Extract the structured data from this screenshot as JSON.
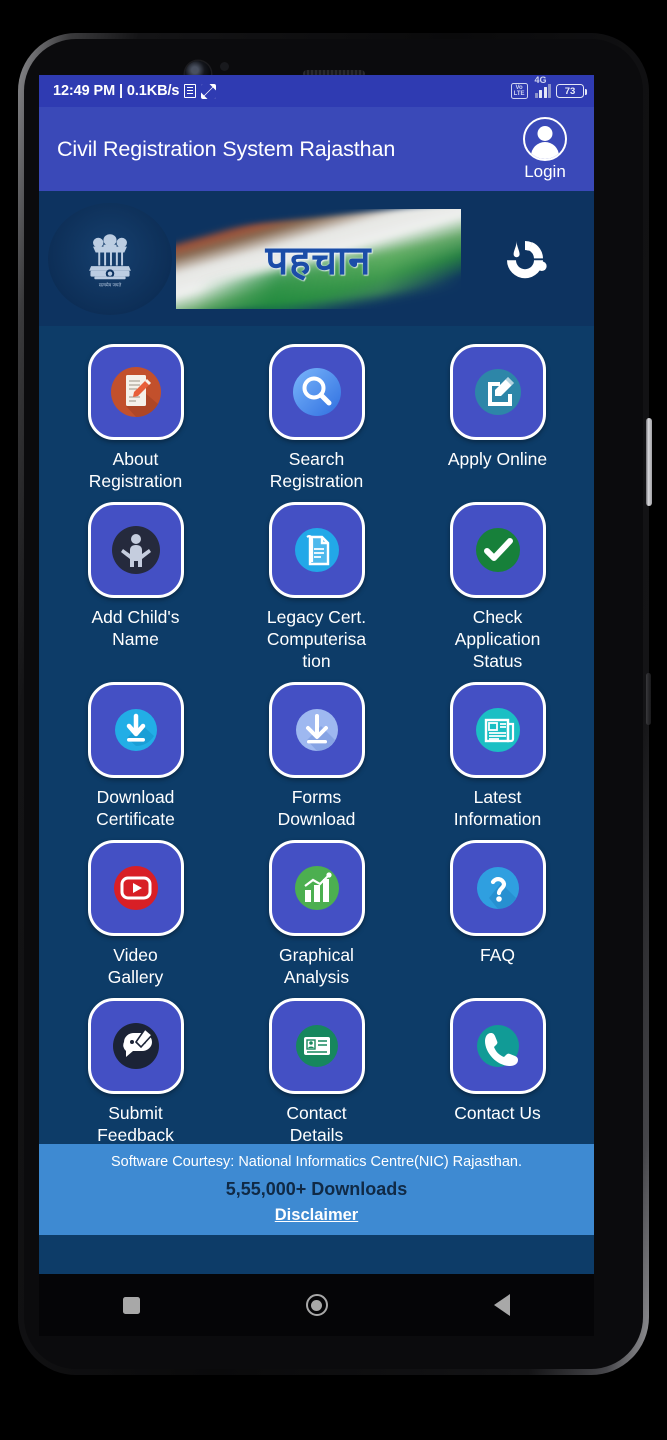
{
  "status_bar": {
    "time_and_speed": "12:49 PM | 0.1KB/s",
    "doc_icon": "document-icon",
    "sync_icon": "sync-icon",
    "volte_line1": "Vo",
    "volte_line2": "LTE",
    "network_type": "4G",
    "battery_percent": "73"
  },
  "app_bar": {
    "title": "Civil Registration System Rajasthan",
    "login_label": "Login",
    "avatar_icon": "user-avatar-icon",
    "background_color": "#3a49b8"
  },
  "banner": {
    "left_emblem": "ashoka-emblem-icon",
    "emblem_motto": "सत्यमेव जयते",
    "center_text": "पहचान",
    "right_logo": "crs-swirl-logo-icon",
    "background_color": "#0d3360"
  },
  "grid": {
    "items": [
      {
        "label": "About\nRegistration",
        "icon": "document-pencil-icon",
        "icon_color": "#c2502c"
      },
      {
        "label": "Search\nRegistration",
        "icon": "magnifier-icon",
        "icon_color": "#3e86f0"
      },
      {
        "label": "Apply Online",
        "icon": "edit-square-icon",
        "icon_color": "#2d86a8"
      },
      {
        "label": "Add Child's\nName",
        "icon": "child-icon",
        "icon_color": "#252a3d"
      },
      {
        "label": "Legacy Cert.\nComputerisa\ntion",
        "icon": "scroll-document-icon",
        "icon_color": "#22a8e8"
      },
      {
        "label": "Check\nApplication\nStatus",
        "icon": "check-circle-icon",
        "icon_color": "#17803a"
      },
      {
        "label": "Download\nCertificate",
        "icon": "download-icon",
        "icon_color": "#22aee6"
      },
      {
        "label": "Forms\nDownload",
        "icon": "download-arrow-icon",
        "icon_color": "#9eb8f0"
      },
      {
        "label": "Latest\nInformation",
        "icon": "newspaper-icon",
        "icon_color": "#1bbfc4"
      },
      {
        "label": "Video\nGallery",
        "icon": "youtube-play-icon",
        "icon_color": "#d81f26"
      },
      {
        "label": "Graphical\nAnalysis",
        "icon": "bar-chart-icon",
        "icon_color": "#4caf50"
      },
      {
        "label": "FAQ",
        "icon": "question-mark-icon",
        "icon_color": "#2f9fe0"
      },
      {
        "label": "Submit\nFeedback",
        "icon": "feedback-chat-icon",
        "icon_color": "#1b2336"
      },
      {
        "label": "Contact\nDetails",
        "icon": "id-card-icon",
        "icon_color": "#17875e"
      },
      {
        "label": "Contact Us",
        "icon": "phone-icon",
        "icon_color": "#119b96"
      }
    ],
    "tile_color": "#4450c4",
    "page_background": "#0d3c68"
  },
  "footer": {
    "courtesy": "Software Courtesy: National Informatics Centre(NIC) Rajasthan.",
    "downloads": "5,55,000+ Downloads",
    "disclaimer": "Disclaimer",
    "background_color": "#3e8ad2"
  },
  "nav_bar": {
    "recents": "recents-square-icon",
    "home": "home-circle-icon",
    "back": "back-triangle-icon"
  }
}
